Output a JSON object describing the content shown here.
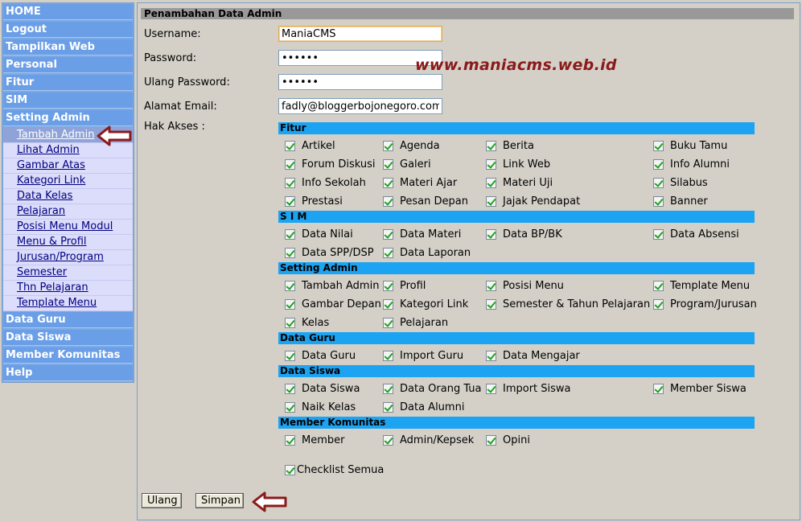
{
  "sidebar": {
    "main_top": [
      "HOME",
      "Logout",
      "Tampilkan Web",
      "Personal",
      "Fitur",
      "SIM",
      "Setting Admin"
    ],
    "sub": [
      "Tambah Admin",
      "Lihat Admin",
      "Gambar Atas",
      "Kategori Link",
      "Data Kelas",
      "Pelajaran",
      "Posisi Menu Modul",
      "Menu & Profil",
      "Jurusan/Program",
      "Semester",
      "Thn Pelajaran",
      "Template Menu"
    ],
    "main_bottom": [
      "Data Guru",
      "Data Siswa",
      "Member Komunitas",
      "Help"
    ]
  },
  "form": {
    "title": "Penambahan Data Admin",
    "username_label": "Username:",
    "username_value": "ManiaCMS",
    "password_label": "Password:",
    "password_value": "••••••",
    "repassword_label": "Ulang Password:",
    "repassword_value": "••••••",
    "email_label": "Alamat Email:",
    "email_value": "fadly@bloggerbojonegoro.com",
    "hak_label": "Hak Akses :"
  },
  "watermark": "www.maniacms.web.id",
  "sections": [
    {
      "title": "Fitur",
      "rows": [
        [
          "Artikel",
          "Agenda",
          "Berita",
          "Buku Tamu"
        ],
        [
          "Forum Diskusi",
          "Galeri",
          "Link Web",
          "Info Alumni"
        ],
        [
          "Info Sekolah",
          "Materi Ajar",
          "Materi Uji",
          "Silabus"
        ],
        [
          "Prestasi",
          "Pesan Depan",
          "Jajak Pendapat",
          "Banner"
        ]
      ]
    },
    {
      "title": "S I M",
      "rows": [
        [
          "Data Nilai",
          "Data Materi",
          "Data BP/BK",
          "Data Absensi"
        ],
        [
          "Data SPP/DSP",
          "Data Laporan"
        ]
      ]
    },
    {
      "title": "Setting Admin",
      "rows": [
        [
          "Tambah Admin",
          "Profil",
          "Posisi Menu",
          "Template Menu"
        ],
        [
          "Gambar Depan",
          "Kategori Link",
          "Semester & Tahun Pelajaran",
          "Program/Jurusan"
        ],
        [
          "Kelas",
          "Pelajaran"
        ]
      ]
    },
    {
      "title": "Data Guru",
      "rows": [
        [
          "Data Guru",
          "Import Guru",
          "Data Mengajar"
        ]
      ]
    },
    {
      "title": "Data Siswa",
      "rows": [
        [
          "Data Siswa",
          "Data Orang Tua",
          "Import Siswa",
          "Member Siswa"
        ],
        [
          "Naik Kelas",
          "Data Alumni"
        ]
      ]
    },
    {
      "title": "Member Komunitas",
      "rows": [
        [
          "Member",
          "Admin/Kepsek",
          "Opini"
        ]
      ]
    }
  ],
  "check_all_label": "Checklist Semua",
  "buttons": {
    "reset": "Ulang",
    "save": "Simpan"
  }
}
